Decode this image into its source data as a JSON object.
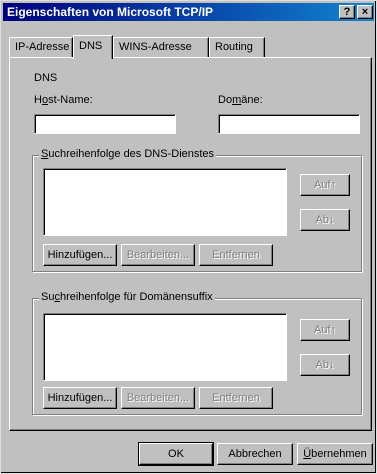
{
  "window": {
    "title": "Eigenschaften von Microsoft TCP/IP",
    "help_btn": "?",
    "close_btn": "×"
  },
  "tabs": [
    "IP-Adresse",
    "DNS",
    "WINS-Adresse",
    "Routing"
  ],
  "dns": {
    "section_label": "DNS",
    "host_label_pre": "H",
    "host_label_u": "o",
    "host_label_post": "st-Name:",
    "host_value": "",
    "domain_label_pre": "Do",
    "domain_label_u": "m",
    "domain_label_post": "äne:",
    "domain_value": ""
  },
  "dns_order": {
    "label_pre": "",
    "label_u": "S",
    "label_post": "uchreihenfolge des DNS-Dienstes",
    "up": "Auf↑",
    "down": "Ab↓",
    "add": "Hinzufügen...",
    "edit": "Bearbeiten...",
    "remove": "Entfernen"
  },
  "suffix_order": {
    "label_pre": "Su",
    "label_u": "c",
    "label_post": "hreihenfolge für Domänensuffix",
    "up": "Auf↑",
    "down": "Ab↓",
    "add": "Hinzufügen...",
    "edit": "Bearbeiten...",
    "remove": "Entfernen"
  },
  "footer": {
    "ok": "OK",
    "cancel": "Abbrechen",
    "apply_pre": "",
    "apply_u": "Ü",
    "apply_post": "bernehmen"
  }
}
